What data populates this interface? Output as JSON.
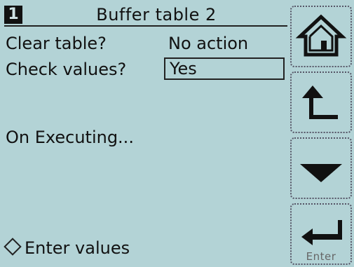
{
  "header": {
    "page_number": "1",
    "title": "Buffer table 2"
  },
  "rows": [
    {
      "label": "Clear table?",
      "value": "No action"
    },
    {
      "label": "Check values?",
      "value": "Yes"
    }
  ],
  "status": {
    "text": "On Executing..."
  },
  "footer": {
    "text": "Enter values"
  },
  "softkeys": [
    {
      "icon": "home-icon"
    },
    {
      "icon": "back-icon"
    },
    {
      "icon": "arrow-down-icon"
    },
    {
      "icon": "enter-icon",
      "label": "Enter"
    }
  ]
}
